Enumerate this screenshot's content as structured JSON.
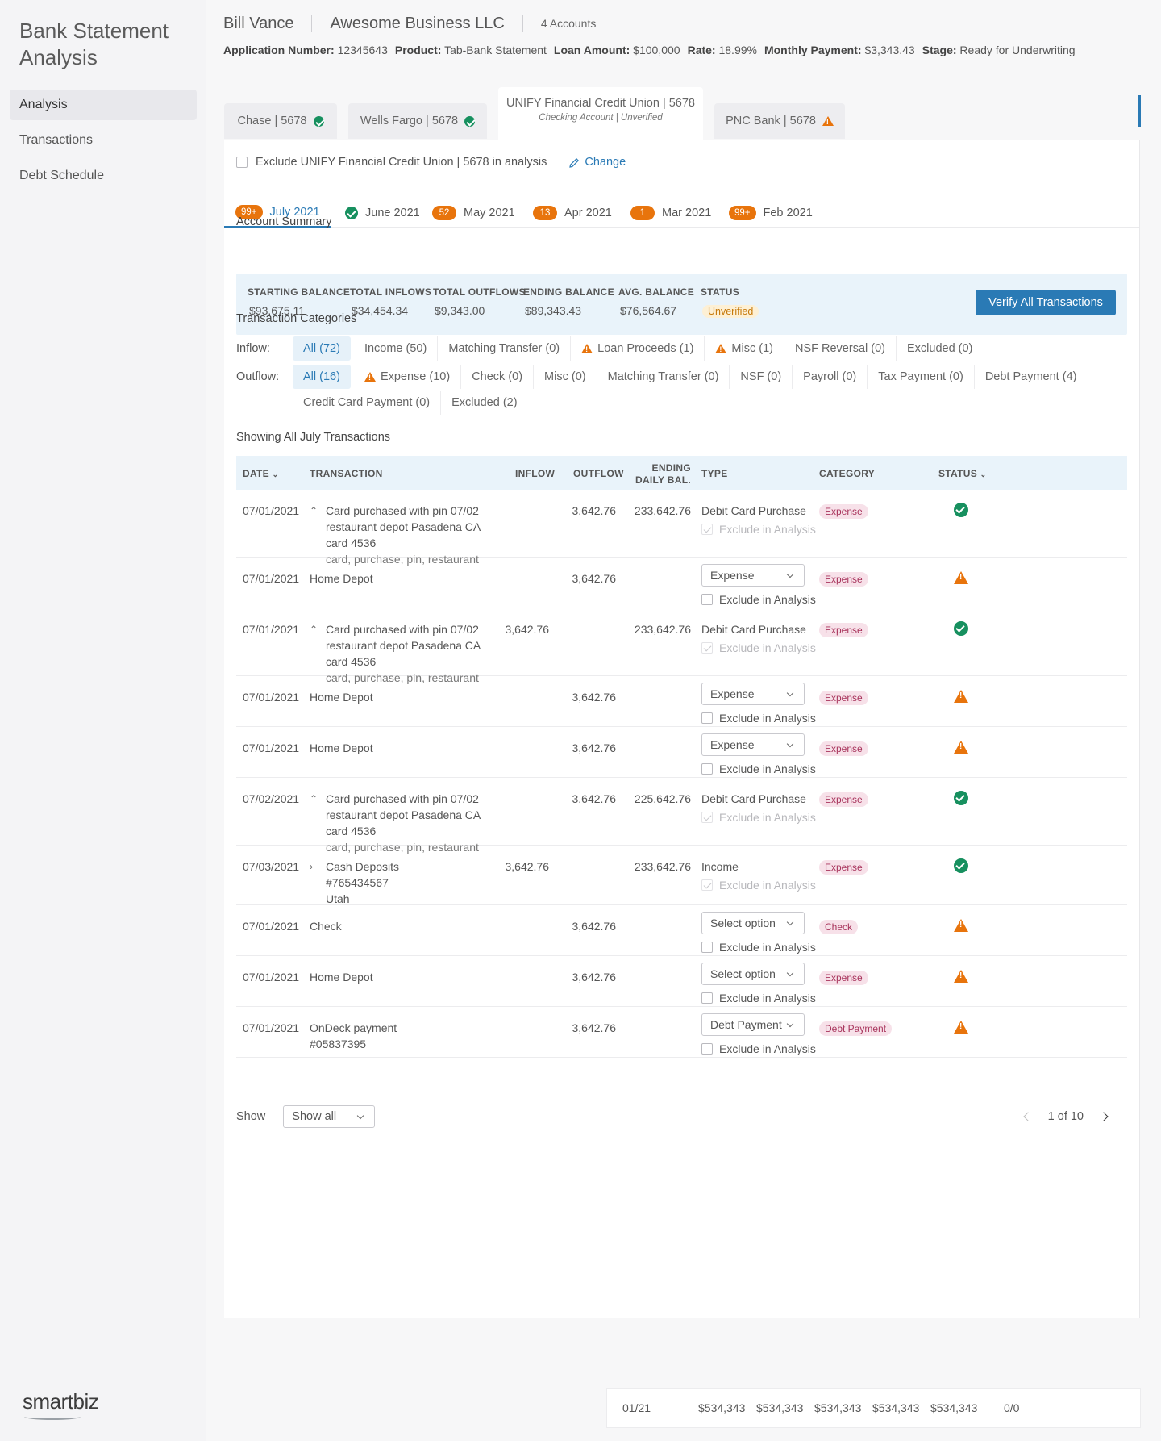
{
  "app": {
    "title": "Bank Statement Analysis",
    "brand": "smartbiz"
  },
  "nav": [
    {
      "label": "Analysis",
      "active": true
    },
    {
      "label": "Transactions",
      "active": false
    },
    {
      "label": "Debt Schedule",
      "active": false
    }
  ],
  "header": {
    "name": "Bill Vance",
    "business": "Awesome Business LLC",
    "accounts": "4 Accounts",
    "fields": [
      {
        "key": "Application Number:",
        "value": "12345643"
      },
      {
        "key": "Product:",
        "value": "Tab-Bank Statement"
      },
      {
        "key": "Loan Amount:",
        "value": "$100,000"
      },
      {
        "key": "Rate:",
        "value": "18.99%"
      },
      {
        "key": "Monthly Payment:",
        "value": "$3,343.43"
      },
      {
        "key": "Stage:",
        "value": "Ready for Underwriting"
      }
    ]
  },
  "bank_tabs": [
    {
      "label": "Chase | 5678",
      "status": "ok"
    },
    {
      "label": "Wells Fargo | 5678",
      "status": "ok"
    },
    {
      "label": "UNIFY Financial Credit Union | 5678",
      "sub": "Checking Account | Unverified",
      "active": true
    },
    {
      "label": "PNC Bank | 5678",
      "status": "warn"
    }
  ],
  "exclude": {
    "label": "Exclude UNIFY Financial Credit Union | 5678 in analysis",
    "change": "Change"
  },
  "month_tabs": [
    {
      "badge": "99+",
      "label": "July 2021",
      "active": true
    },
    {
      "badge": "",
      "label": "June 2021",
      "ok": true
    },
    {
      "badge": "52",
      "label": "May 2021"
    },
    {
      "badge": "13",
      "label": "Apr 2021"
    },
    {
      "badge": "1",
      "label": "Mar 2021"
    },
    {
      "badge": "99+",
      "label": "Feb 2021"
    }
  ],
  "summary": {
    "title": "Account Summary",
    "starting_balance": {
      "label": "STARTING BALANCE",
      "value": "$93,675.11"
    },
    "total_inflows": {
      "label": "TOTAL INFLOWS",
      "value": "$34,454.34"
    },
    "total_outflows": {
      "label": "TOTAL OUTFLOWS",
      "value": "$9,343.00"
    },
    "ending_balance": {
      "label": "ENDING BALANCE",
      "value": "$89,343.43"
    },
    "avg_balance": {
      "label": "AVG. BALANCE",
      "value": "$76,564.67"
    },
    "status": {
      "label": "STATUS",
      "value": "Unverified"
    },
    "verify_button": "Verify All Transactions"
  },
  "categories": {
    "title": "Transaction Categories",
    "inflow_label": "Inflow:",
    "inflow": [
      {
        "label": "All (72)",
        "active": true
      },
      {
        "label": "Income (50)"
      },
      {
        "label": "Matching Transfer (0)"
      },
      {
        "label": "Loan Proceeds (1)",
        "warn": true
      },
      {
        "label": "Misc (1)",
        "warn": true
      },
      {
        "label": "NSF Reversal (0)"
      },
      {
        "label": "Excluded (0)"
      }
    ],
    "outflow_label": "Outflow:",
    "outflow": [
      {
        "label": "All (16)",
        "active": true
      },
      {
        "label": "Expense (10)",
        "warn": true
      },
      {
        "label": "Check (0)"
      },
      {
        "label": "Misc (0)"
      },
      {
        "label": "Matching Transfer (0)"
      },
      {
        "label": "NSF (0)"
      },
      {
        "label": "Payroll (0)"
      },
      {
        "label": "Tax Payment (0)"
      },
      {
        "label": "Debt Payment (4)"
      }
    ],
    "outflow_row2": [
      {
        "label": "Credit Card Payment (0)"
      },
      {
        "label": "Excluded (2)"
      }
    ]
  },
  "table": {
    "title": "Showing All July Transactions",
    "columns": {
      "date": "DATE",
      "transaction": "TRANSACTION",
      "inflow": "INFLOW",
      "outflow": "OUTFLOW",
      "ending": "ENDING DAILY BAL.",
      "type": "TYPE",
      "category": "CATEGORY",
      "status": "STATUS"
    },
    "exclude_label": "Exclude in Analysis",
    "rows": [
      {
        "date": "07/01/2021",
        "chev": "^",
        "lines": [
          "Card purchased with pin 07/02",
          "restaurant depot Pasadena CA",
          "card 4536"
        ],
        "tags": "card, purchase, pin, restaurant",
        "inflow": "",
        "outflow": "3,642.76",
        "ending": "233,642.76",
        "type": "Debit Card Purchase",
        "select": "",
        "category": "Expense",
        "status": "ok"
      },
      {
        "date": "07/01/2021",
        "chev": "",
        "lines": [
          "Home Depot"
        ],
        "tags": "",
        "inflow": "",
        "outflow": "3,642.76",
        "ending": "",
        "type": "",
        "select": "Expense",
        "category": "Expense",
        "status": "warn"
      },
      {
        "date": "07/01/2021",
        "chev": "^",
        "lines": [
          "Card purchased with pin 07/02",
          "restaurant depot Pasadena CA",
          "card 4536"
        ],
        "tags": "card, purchase, pin, restaurant",
        "inflow": "3,642.76",
        "outflow": "",
        "ending": "233,642.76",
        "type": "Debit Card Purchase",
        "select": "",
        "category": "Expense",
        "status": "ok"
      },
      {
        "date": "07/01/2021",
        "chev": "",
        "lines": [
          "Home Depot"
        ],
        "tags": "",
        "inflow": "",
        "outflow": "3,642.76",
        "ending": "",
        "type": "",
        "select": "Expense",
        "category": "Expense",
        "status": "warn"
      },
      {
        "date": "07/01/2021",
        "chev": "",
        "lines": [
          "Home Depot"
        ],
        "tags": "",
        "inflow": "",
        "outflow": "3,642.76",
        "ending": "",
        "type": "",
        "select": "Expense",
        "category": "Expense",
        "status": "warn"
      },
      {
        "date": "07/02/2021",
        "chev": "^",
        "lines": [
          "Card purchased with pin 07/02",
          "restaurant depot Pasadena CA",
          "card 4536"
        ],
        "tags": "card, purchase, pin, restaurant",
        "inflow": "",
        "outflow": "3,642.76",
        "ending": "225,642.76",
        "type": "Debit Card Purchase",
        "select": "",
        "category": "Expense",
        "status": "ok"
      },
      {
        "date": "07/03/2021",
        "chev": ">",
        "lines": [
          "Cash Deposits",
          "#765434567",
          "Utah"
        ],
        "tags": "",
        "inflow": "3,642.76",
        "outflow": "",
        "ending": "233,642.76",
        "type": "Income",
        "select": "",
        "category": "Expense",
        "status": "ok"
      },
      {
        "date": "07/01/2021",
        "chev": "",
        "lines": [
          "Check"
        ],
        "tags": "",
        "inflow": "",
        "outflow": "3,642.76",
        "ending": "",
        "type": "",
        "select": "Select option",
        "category": "Check",
        "status": "warn"
      },
      {
        "date": "07/01/2021",
        "chev": "",
        "lines": [
          "Home Depot"
        ],
        "tags": "",
        "inflow": "",
        "outflow": "3,642.76",
        "ending": "",
        "type": "",
        "select": "Select option",
        "category": "Expense",
        "status": "warn"
      },
      {
        "date": "07/01/2021",
        "chev": "",
        "lines": [
          "OnDeck payment",
          "#05837395"
        ],
        "tags": "",
        "inflow": "",
        "outflow": "3,642.76",
        "ending": "",
        "type": "",
        "select": "Debt Payment",
        "category": "Debt Payment",
        "status": "warn"
      }
    ]
  },
  "footer": {
    "show_label": "Show",
    "show_value": "Show all",
    "page_text": "1 of 10"
  },
  "bottom_strip": [
    "01/21",
    "$534,343",
    "$534,343",
    "$534,343",
    "$534,343",
    "$534,343",
    "0/0"
  ],
  "colors": {
    "accent": "#2a7ab5",
    "warning": "#e8740c",
    "success": "#17905f",
    "pill": "#a8345c"
  }
}
